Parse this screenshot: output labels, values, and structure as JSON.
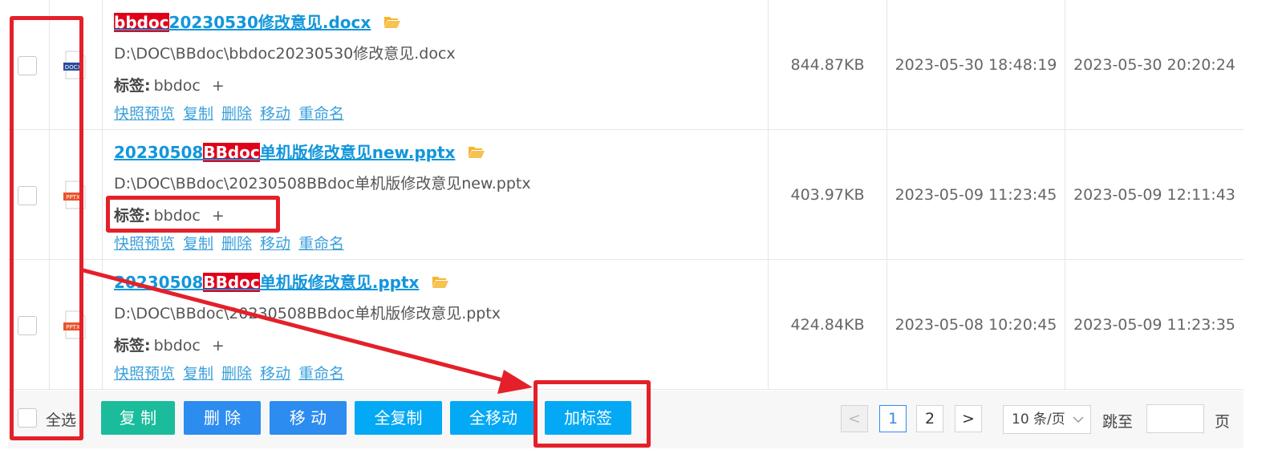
{
  "files": [
    {
      "title_pre": "",
      "title_hl": "bbdoc",
      "title_post": "20230530修改意见.docx",
      "path": "D:\\DOC\\BBdoc\\bbdoc20230530修改意见.docx",
      "tag_label": "标签:",
      "tag_value": "bbdoc",
      "tag_add": "+",
      "size": "844.87KB",
      "created": "2023-05-30 18:48:19",
      "modified": "2023-05-30 20:20:24",
      "icon_text": "DOCX",
      "icon_color": "#2b4c9a"
    },
    {
      "title_pre": "20230508",
      "title_hl": "BBdoc",
      "title_post": "单机版修改意见new.pptx",
      "path": "D:\\DOC\\BBdoc\\20230508BBdoc单机版修改意见new.pptx",
      "tag_label": "标签:",
      "tag_value": "bbdoc",
      "tag_add": "+",
      "size": "403.97KB",
      "created": "2023-05-09 11:23:45",
      "modified": "2023-05-09 12:11:43",
      "icon_text": "PPTX",
      "icon_color": "#e8552c"
    },
    {
      "title_pre": "20230508",
      "title_hl": "BBdoc",
      "title_post": "单机版修改意见.pptx",
      "path": "D:\\DOC\\BBdoc\\20230508BBdoc单机版修改意见.pptx",
      "tag_label": "标签:",
      "tag_value": "bbdoc",
      "tag_add": "+",
      "size": "424.84KB",
      "created": "2023-05-08 10:20:45",
      "modified": "2023-05-09 11:23:35",
      "icon_text": "PPTX",
      "icon_color": "#e8552c"
    }
  ],
  "row_actions": [
    "快照预览",
    "复制",
    "删除",
    "移动",
    "重命名"
  ],
  "footer": {
    "select_all": "全选",
    "buttons": {
      "copy": "复 制",
      "delete": "删 除",
      "move": "移 动",
      "copy_all": "全复制",
      "move_all": "全移动",
      "add_tag": "加标签"
    },
    "pagination": {
      "prev": "<",
      "pages": [
        "1",
        "2"
      ],
      "current_page": "1",
      "next": ">",
      "page_size": "10 条/页",
      "jump_label": "跳至",
      "page_suffix": "页"
    }
  },
  "colors": {
    "link": "#1296db",
    "highlight_bg": "#e0001a",
    "folder_icon": "#f5b731",
    "annotation": "#e4202a",
    "btn_green": "#1abc9c",
    "btn_blue": "#2d8cf0",
    "btn_light_blue": "#03a9f4"
  }
}
